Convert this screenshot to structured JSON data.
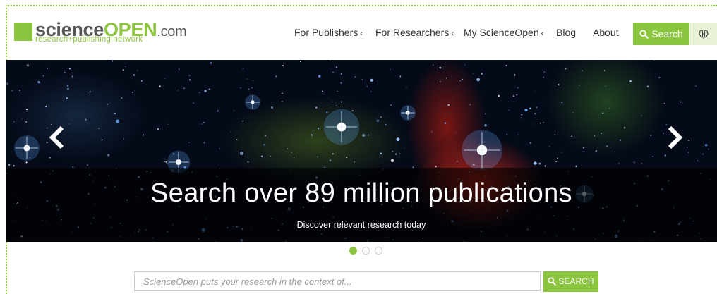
{
  "logo": {
    "part1": "science",
    "part2": "OPEN",
    "part3": ".com",
    "tagline": "research+publishing network"
  },
  "nav": {
    "items": [
      {
        "label": "For Publishers",
        "chevron": "‹"
      },
      {
        "label": "For Researchers",
        "chevron": "‹"
      },
      {
        "label": "My ScienceOpen",
        "chevron": "‹"
      },
      {
        "label": "Blog",
        "chevron": ""
      },
      {
        "label": "About",
        "chevron": ""
      }
    ],
    "search_label": "Search"
  },
  "hero": {
    "title": "Search over 89 million publications",
    "subtitle": "Discover relevant research today",
    "prev_icon": "chevron-left-icon",
    "next_icon": "chevron-right-icon",
    "slides": 3,
    "active_slide": 1
  },
  "search": {
    "placeholder": "ScienceOpen puts your research in the context of...",
    "button_label": "SEARCH"
  },
  "colors": {
    "brand_green": "#8cc63f",
    "text_dark": "#333333"
  }
}
